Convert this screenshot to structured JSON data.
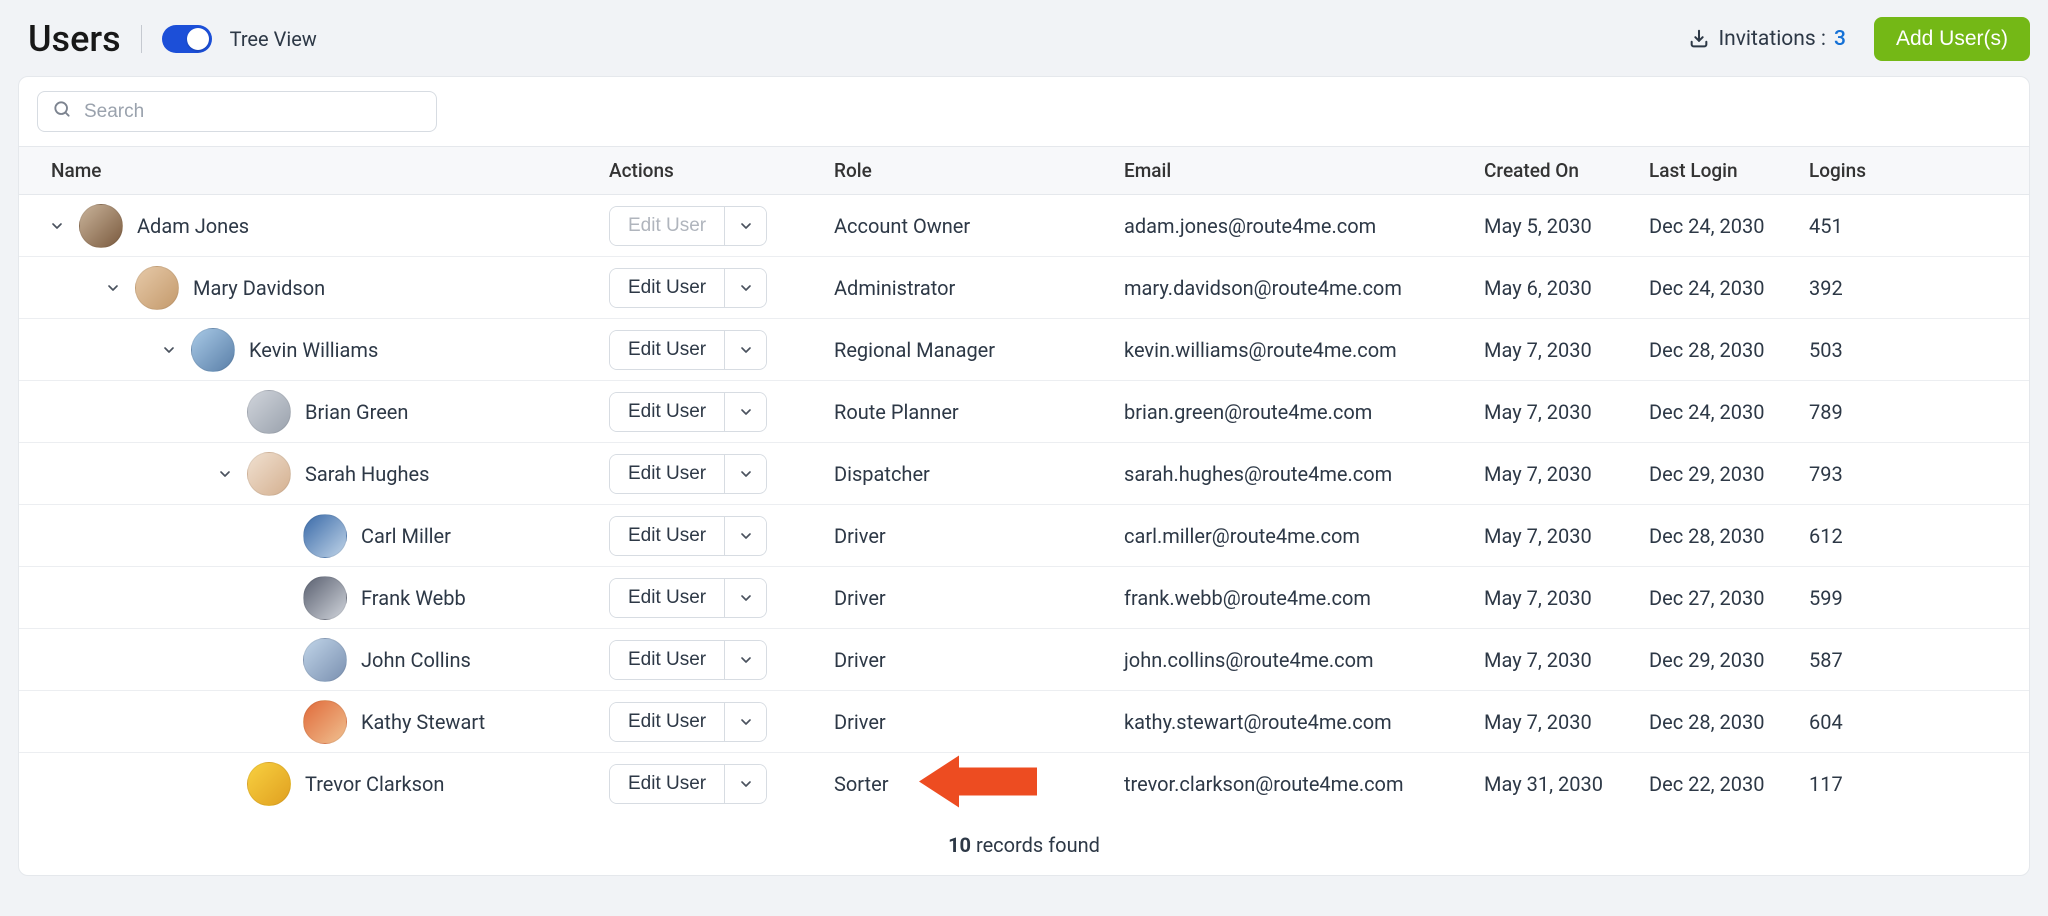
{
  "header": {
    "title": "Users",
    "tree_view_label": "Tree View",
    "invitations_label": "Invitations :",
    "invitations_count": "3",
    "add_label": "Add User(s)"
  },
  "search": {
    "placeholder": "Search"
  },
  "columns": {
    "name": "Name",
    "actions": "Actions",
    "role": "Role",
    "email": "Email",
    "created_on": "Created On",
    "last_login": "Last Login",
    "logins": "Logins"
  },
  "edit_label": "Edit User",
  "footer": {
    "count": "10",
    "suffix": " records found"
  },
  "avatar_colors": [
    "linear-gradient(135deg,#c9b39a,#7a5a3e)",
    "linear-gradient(135deg,#e6c9a8,#c49a6c)",
    "linear-gradient(135deg,#a8c9e6,#5a7fa8)",
    "linear-gradient(135deg,#d0d4db,#9aa2ad)",
    "linear-gradient(135deg,#f0e0d0,#d4b090)",
    "linear-gradient(135deg,#3a6aa8,#c0d4e8)",
    "linear-gradient(135deg,#5a6070,#d0d4db)",
    "linear-gradient(135deg,#c0d4e8,#7a90b0)",
    "linear-gradient(135deg,#e06a3a,#f0c090)",
    "linear-gradient(135deg,#f8d040,#e0a020)"
  ],
  "users": [
    {
      "indent": 0,
      "chev": true,
      "name": "Adam Jones",
      "disabled": true,
      "role": "Account Owner",
      "email": "adam.jones@route4me.com",
      "created": "May 5, 2030",
      "last": "Dec 24, 2030",
      "logins": "451",
      "arrow": false
    },
    {
      "indent": 1,
      "chev": true,
      "name": "Mary Davidson",
      "disabled": false,
      "role": "Administrator",
      "email": "mary.davidson@route4me.com",
      "created": "May 6, 2030",
      "last": "Dec 24, 2030",
      "logins": "392",
      "arrow": false
    },
    {
      "indent": 2,
      "chev": true,
      "name": "Kevin Williams",
      "disabled": false,
      "role": "Regional Manager",
      "email": "kevin.williams@route4me.com",
      "created": "May 7, 2030",
      "last": "Dec 28, 2030",
      "logins": "503",
      "arrow": false
    },
    {
      "indent": 3,
      "chev": false,
      "name": "Brian Green",
      "disabled": false,
      "role": "Route Planner",
      "email": "brian.green@route4me.com",
      "created": "May 7, 2030",
      "last": "Dec 24, 2030",
      "logins": "789",
      "arrow": false
    },
    {
      "indent": 3,
      "chev": true,
      "name": "Sarah Hughes",
      "disabled": false,
      "role": "Dispatcher",
      "email": "sarah.hughes@route4me.com",
      "created": "May 7, 2030",
      "last": "Dec 29, 2030",
      "logins": "793",
      "arrow": false
    },
    {
      "indent": 4,
      "chev": false,
      "name": "Carl Miller",
      "disabled": false,
      "role": "Driver",
      "email": "carl.miller@route4me.com",
      "created": "May 7, 2030",
      "last": "Dec 28, 2030",
      "logins": "612",
      "arrow": false
    },
    {
      "indent": 4,
      "chev": false,
      "name": "Frank Webb",
      "disabled": false,
      "role": "Driver",
      "email": "frank.webb@route4me.com",
      "created": "May 7, 2030",
      "last": "Dec 27, 2030",
      "logins": "599",
      "arrow": false
    },
    {
      "indent": 4,
      "chev": false,
      "name": "John Collins",
      "disabled": false,
      "role": "Driver",
      "email": "john.collins@route4me.com",
      "created": "May 7, 2030",
      "last": "Dec 29, 2030",
      "logins": "587",
      "arrow": false
    },
    {
      "indent": 4,
      "chev": false,
      "name": "Kathy Stewart",
      "disabled": false,
      "role": "Driver",
      "email": "kathy.stewart@route4me.com",
      "created": "May 7, 2030",
      "last": "Dec 28, 2030",
      "logins": "604",
      "arrow": false
    },
    {
      "indent": 3,
      "chev": false,
      "name": "Trevor Clarkson",
      "disabled": false,
      "role": "Sorter",
      "email": "trevor.clarkson@route4me.com",
      "created": "May 31, 2030",
      "last": "Dec 22, 2030",
      "logins": "117",
      "arrow": true
    }
  ]
}
